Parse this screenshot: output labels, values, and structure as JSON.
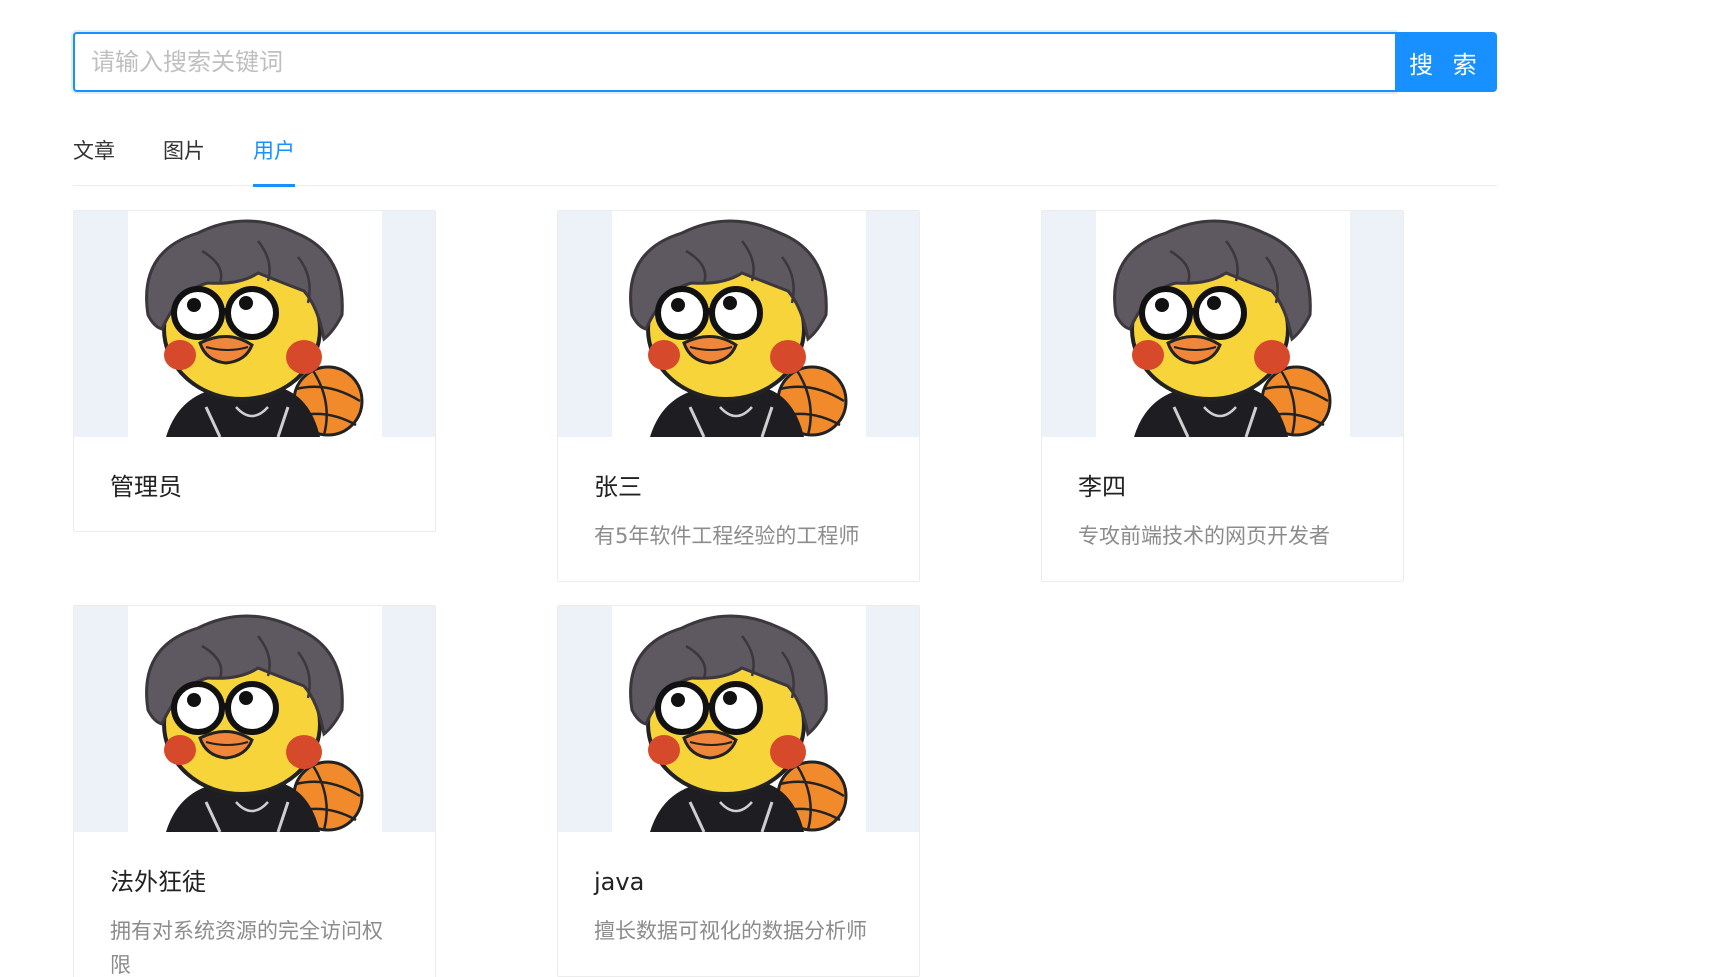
{
  "search": {
    "placeholder": "请输入搜索关键词",
    "value": "",
    "button_label": "搜 索"
  },
  "tabs": [
    {
      "label": "文章",
      "active": false
    },
    {
      "label": "图片",
      "active": false
    },
    {
      "label": "用户",
      "active": true
    }
  ],
  "users": [
    {
      "name": "管理员",
      "description": ""
    },
    {
      "name": "张三",
      "description": "有5年软件工程经验的工程师"
    },
    {
      "name": "李四",
      "description": "专攻前端技术的网页开发者"
    },
    {
      "name": "法外狂徒",
      "description": "拥有对系统资源的完全访问权限"
    },
    {
      "name": "java",
      "description": "擅长数据可视化的数据分析师"
    }
  ],
  "colors": {
    "accent": "#1890ff",
    "cover_bg": "#edf2f8",
    "muted_text": "#8c8c8c"
  },
  "icons": {
    "avatar": "duck-with-hair-and-basketball-avatar"
  }
}
